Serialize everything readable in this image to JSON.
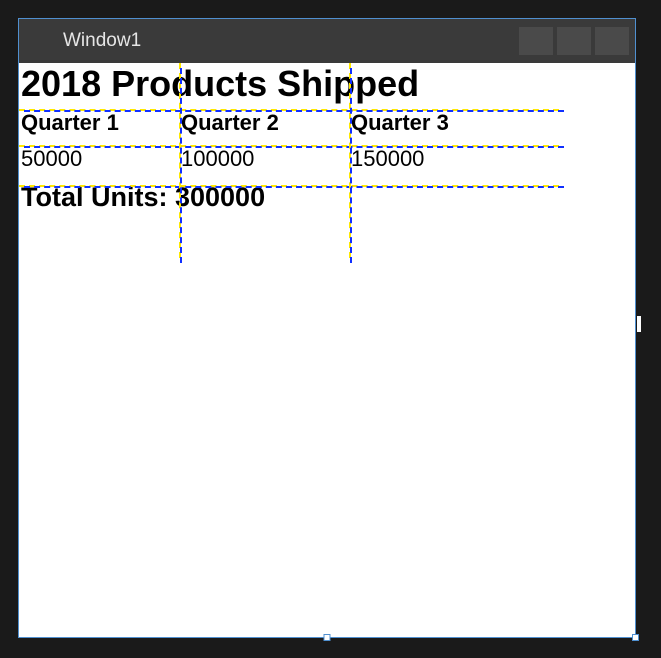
{
  "window": {
    "title": "Window1"
  },
  "content": {
    "title": "2018 Products Shipped",
    "headers": {
      "q1": "Quarter 1",
      "q2": "Quarter 2",
      "q3": "Quarter 3"
    },
    "values": {
      "q1": "50000",
      "q2": "100000",
      "q3": "150000"
    },
    "total": "Total Units: 300000"
  },
  "chart_data": {
    "type": "table",
    "title": "2018 Products Shipped",
    "categories": [
      "Quarter 1",
      "Quarter 2",
      "Quarter 3"
    ],
    "values": [
      50000,
      100000,
      150000
    ],
    "total_label": "Total Units",
    "total_value": 300000
  }
}
